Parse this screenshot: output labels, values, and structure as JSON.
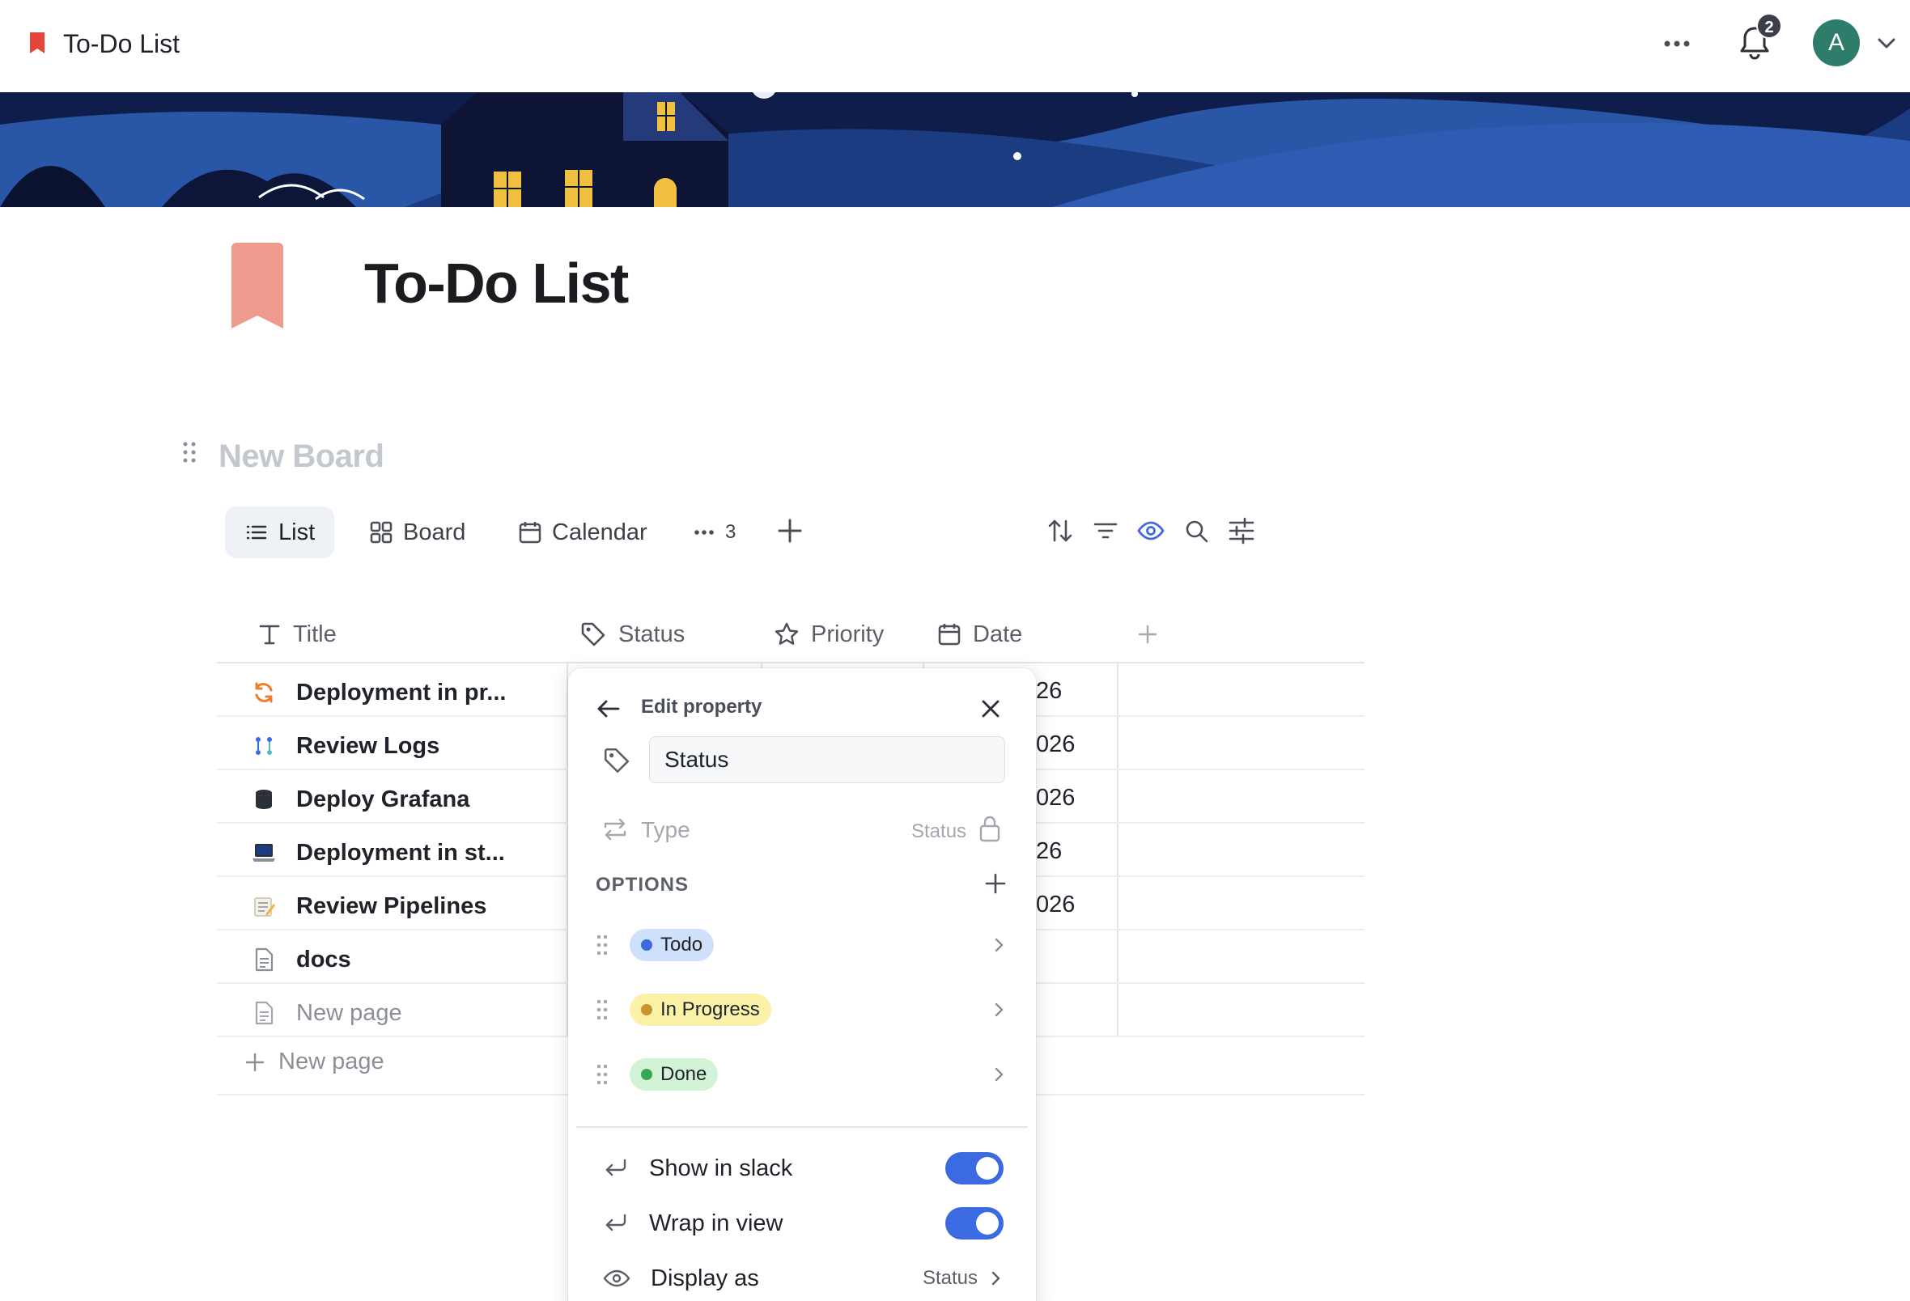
{
  "app": {
    "title": "To-Do List",
    "notifications_count": "2",
    "avatar_initial": "A"
  },
  "page": {
    "title": "To-Do List",
    "board_title": "New Board"
  },
  "views": {
    "tabs": [
      {
        "label": "List",
        "icon": "list-icon",
        "active": true
      },
      {
        "label": "Board",
        "icon": "board-grid-icon",
        "active": false
      },
      {
        "label": "Calendar",
        "icon": "calendar-icon",
        "active": false
      }
    ],
    "more_count": "3"
  },
  "table": {
    "columns": [
      {
        "label": "Title",
        "icon": "text-type-icon"
      },
      {
        "label": "Status",
        "icon": "tag-icon"
      },
      {
        "label": "Priority",
        "icon": "star-icon"
      },
      {
        "label": "Date",
        "icon": "calendar-icon"
      }
    ],
    "rows": [
      {
        "title": "Deployment in pr...",
        "icon": "refresh-orange-icon",
        "date_fragment": "26"
      },
      {
        "title": "Review Logs",
        "icon": "git-branch-icon",
        "date_fragment": "026"
      },
      {
        "title": "Deploy Grafana",
        "icon": "database-icon",
        "date_fragment": "026"
      },
      {
        "title": "Deployment in st...",
        "icon": "laptop-icon",
        "date_fragment": "26"
      },
      {
        "title": "Review Pipelines",
        "icon": "memo-icon",
        "date_fragment": "026"
      },
      {
        "title": "docs",
        "icon": "document-icon",
        "date_fragment": ""
      },
      {
        "title": "New page",
        "icon": "document-icon",
        "date_fragment": ""
      }
    ],
    "new_page_label": "New page"
  },
  "edit_property": {
    "header": "Edit property",
    "name_value": "Status",
    "type_label": "Type",
    "type_value": "Status",
    "options_label": "OPTIONS",
    "options": [
      {
        "label": "Todo",
        "bg": "#cfe0fb",
        "dot": "#3c6ae0"
      },
      {
        "label": "In Progress",
        "bg": "#fbf2a8",
        "dot": "#c9952a"
      },
      {
        "label": "Done",
        "bg": "#d3f3d6",
        "dot": "#3aa655"
      }
    ],
    "settings": [
      {
        "label": "Show in slack",
        "toggle": true
      },
      {
        "label": "Wrap in view",
        "toggle": true
      },
      {
        "label": "Display as",
        "value": "Status"
      }
    ]
  },
  "colors": {
    "accent": "#3c6ae0",
    "page_icon": "#ee9a8d",
    "bookmark": "#e5453a"
  }
}
